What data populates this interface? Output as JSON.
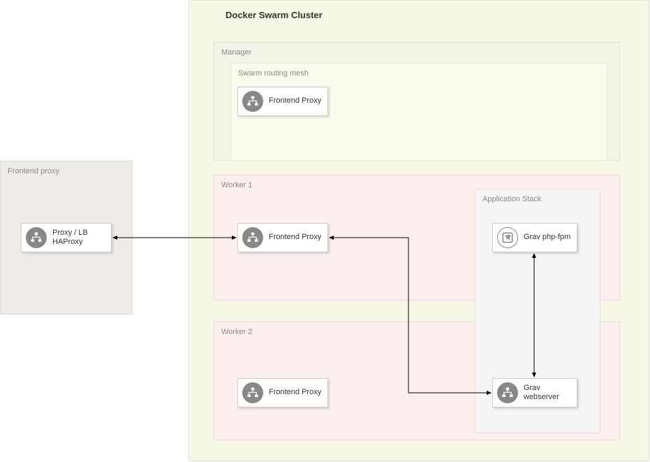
{
  "title": "Docker Swarm Cluster",
  "external": {
    "label": "Frontend proxy",
    "node": {
      "line1": "Proxy / LB",
      "line2": "HAProxy"
    }
  },
  "manager": {
    "label": "Manager",
    "mesh": {
      "label": "Swarm routing mesh",
      "node": "Frontend Proxy"
    }
  },
  "worker1": {
    "label": "Worker 1",
    "proxy": "Frontend Proxy"
  },
  "worker2": {
    "label": "Worker 2",
    "proxy": "Frontend Proxy"
  },
  "stack": {
    "label": "Application Stack",
    "phpfpm": "Grav php-fpm",
    "webserver": "Grav webserver"
  }
}
